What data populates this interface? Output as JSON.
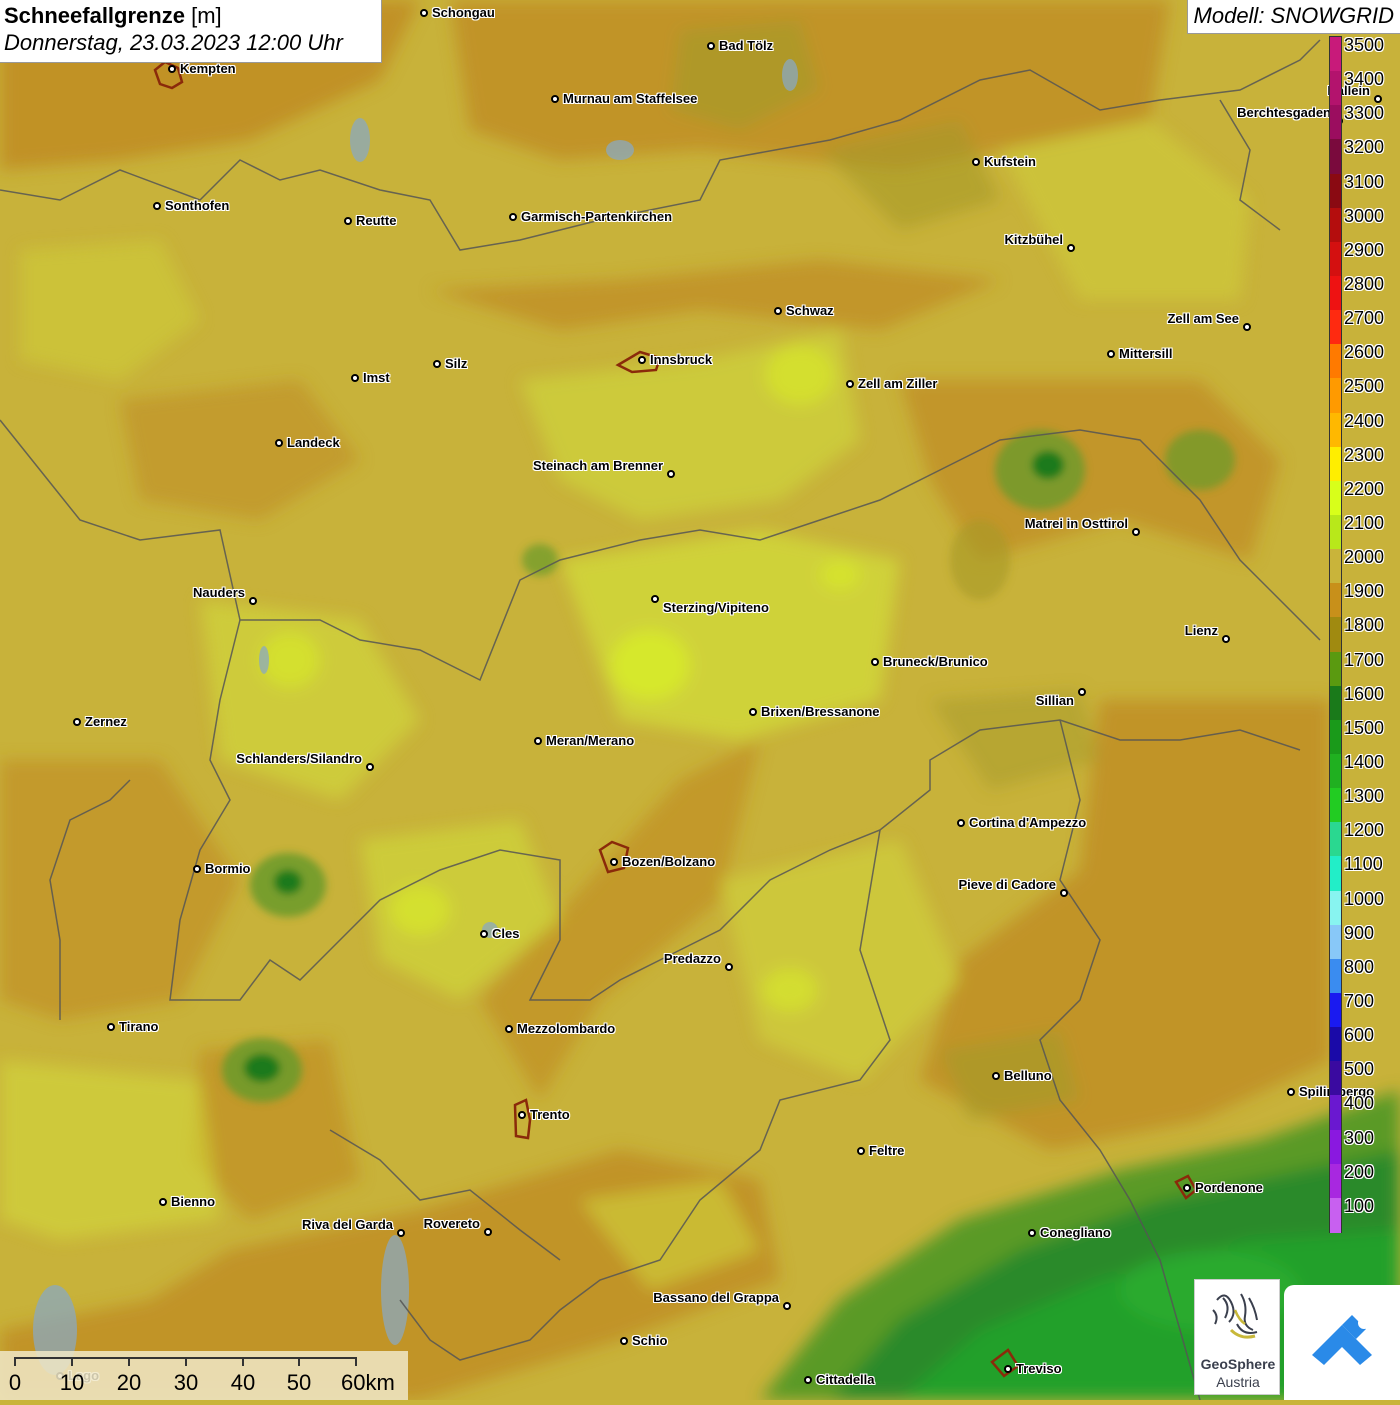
{
  "header": {
    "title_bold": "Schneefallgrenze",
    "title_unit": "[m]",
    "datetime": "Donnerstag, 23.03.2023 12:00 Uhr",
    "model": "Modell: SNOWGRID"
  },
  "legend": {
    "levels": [
      "3500",
      "3400",
      "3300",
      "3200",
      "3100",
      "3000",
      "2900",
      "2800",
      "2700",
      "2600",
      "2500",
      "2400",
      "2300",
      "2200",
      "2100",
      "2000",
      "1900",
      "1800",
      "1700",
      "1600",
      "1500",
      "1400",
      "1300",
      "1200",
      "1100",
      "1000",
      "900",
      "800",
      "700",
      "600",
      "500",
      "400",
      "300",
      "200",
      "100"
    ],
    "colors": [
      "#c81a7a",
      "#b3136d",
      "#9b0d5f",
      "#7a0a3d",
      "#8a0a12",
      "#b40d0d",
      "#d41010",
      "#ee1212",
      "#ff2a10",
      "#ff7a00",
      "#ff9a00",
      "#ffb800",
      "#ffee00",
      "#d8ff1a",
      "#b8e81a",
      "#c9b43a",
      "#c8901a",
      "#a08a10",
      "#5a9a10",
      "#1a7a1a",
      "#1a9a1a",
      "#20b020",
      "#22cc22",
      "#2ad890",
      "#22eec8",
      "#88f4f0",
      "#88c8f8",
      "#3a8cf0",
      "#1a1af0",
      "#1a0aa8",
      "#3a0aa0",
      "#6a18d0",
      "#8a18e0",
      "#a828e0",
      "#c860f0"
    ]
  },
  "cities": [
    {
      "name": "Schongau"
    },
    {
      "name": "Bad Tölz"
    },
    {
      "name": "Kempten"
    },
    {
      "name": "Murnau am Staffelsee"
    },
    {
      "name": "Berchtesgaden"
    },
    {
      "name": "Kufstein"
    },
    {
      "name": "Sonthofen"
    },
    {
      "name": "Reutte"
    },
    {
      "name": "Garmisch-Partenkirchen"
    },
    {
      "name": "Kitzbühel"
    },
    {
      "name": "Schwaz"
    },
    {
      "name": "Zell am See"
    },
    {
      "name": "Imst"
    },
    {
      "name": "Silz"
    },
    {
      "name": "Innsbruck"
    },
    {
      "name": "Mittersill"
    },
    {
      "name": "Zell am Ziller"
    },
    {
      "name": "Landeck"
    },
    {
      "name": "Steinach am Brenner"
    },
    {
      "name": "Matrei in Osttirol"
    },
    {
      "name": "Nauders"
    },
    {
      "name": "Sterzing/Vipiteno"
    },
    {
      "name": "Lienz"
    },
    {
      "name": "Bruneck/Brunico"
    },
    {
      "name": "Sillian"
    },
    {
      "name": "Zernez"
    },
    {
      "name": "Brixen/Bressanone"
    },
    {
      "name": "Meran/Merano"
    },
    {
      "name": "Schlanders/Silandro"
    },
    {
      "name": "Cortina d'Ampezzo"
    },
    {
      "name": "Bormio"
    },
    {
      "name": "Bozen/Bolzano"
    },
    {
      "name": "Pieve di Cadore"
    },
    {
      "name": "Cles"
    },
    {
      "name": "Predazzo"
    },
    {
      "name": "Tirano"
    },
    {
      "name": "Mezzolombardo"
    },
    {
      "name": "Belluno"
    },
    {
      "name": "Spilimbergo"
    },
    {
      "name": "Trento"
    },
    {
      "name": "Feltre"
    },
    {
      "name": "Pordenone"
    },
    {
      "name": "Bienno"
    },
    {
      "name": "Riva del Garda"
    },
    {
      "name": "Rovereto"
    },
    {
      "name": "Conegliano"
    },
    {
      "name": "Bassano del Grappa"
    },
    {
      "name": "Schio"
    },
    {
      "name": "Treviso"
    },
    {
      "name": "Cittadella"
    },
    {
      "name": "Hallein"
    },
    {
      "name": "Lago"
    }
  ],
  "scale": {
    "labels": [
      "0",
      "10",
      "20",
      "30",
      "40",
      "50",
      "60km"
    ]
  },
  "logos": {
    "geosphere_line1": "GeoSphere",
    "geosphere_line2": "Austria"
  }
}
